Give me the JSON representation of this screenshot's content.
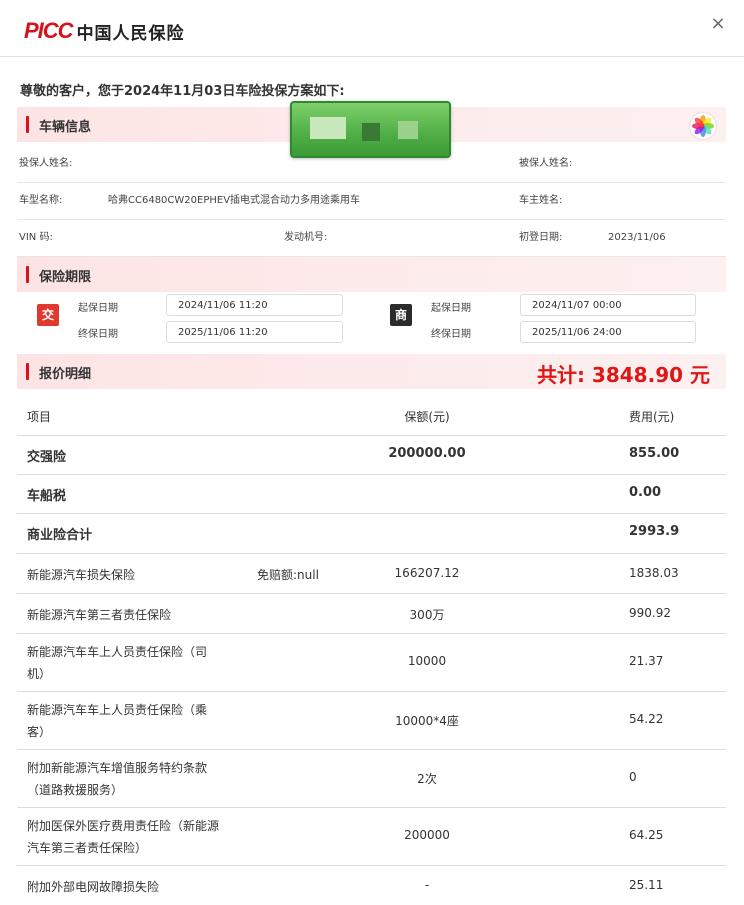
{
  "header": {
    "logo_latin": "PICC",
    "logo_cn": "中国人民保险",
    "close_label": "×"
  },
  "greeting": "尊敬的客户，您于2024年11月03日车险投保方案如下:",
  "vehicle": {
    "section_title": "车辆信息",
    "policyholder_label": "投保人姓名:",
    "insured_label": "被保人姓名:",
    "model_label": "车型名称:",
    "model_value": "哈弗CC6480CW20EPHEV插电式混合动力多用途乘用车",
    "owner_label": "车主姓名:",
    "vin_label": "VIN 码:",
    "engine_label": "发动机号:",
    "first_reg_label": "初登日期:",
    "first_reg_value": "2023/11/06"
  },
  "period": {
    "section_title": "保险期限",
    "compulsory_badge": "交",
    "commercial_badge": "商",
    "start_label": "起保日期",
    "end_label": "终保日期",
    "compulsory_start": "2024/11/06 11:20",
    "compulsory_end": "2025/11/06 11:20",
    "commercial_start": "2024/11/07 00:00",
    "commercial_end": "2025/11/06 24:00"
  },
  "quote": {
    "section_title": "报价明细",
    "total_label": "共计: 3848.90 元",
    "columns": [
      "项目",
      "保额(元)",
      "费用(元)"
    ],
    "rows": [
      {
        "item": "交强险",
        "note": "",
        "amount": "200000.00",
        "fee": "855.00"
      },
      {
        "item": "车船税",
        "note": "",
        "amount": "",
        "fee": "0.00"
      },
      {
        "item": "商业险合计",
        "note": "",
        "amount": "",
        "fee": "2993.9"
      },
      {
        "item": "新能源汽车损失保险",
        "note": "免赔额:null",
        "amount": "166207.12",
        "fee": "1838.03"
      },
      {
        "item": "新能源汽车第三者责任保险",
        "note": "",
        "amount": "300万",
        "fee": "990.92"
      },
      {
        "item_line1": "新能源汽车车上人员责任保险（司",
        "item_line2": "机）",
        "amount": "10000",
        "fee": "21.37"
      },
      {
        "item_line1": "新能源汽车车上人员责任保险（乘",
        "item_line2": "客）",
        "amount": "10000*4座",
        "fee": "54.22"
      },
      {
        "item_line1": "附加新能源汽车增值服务特约条款",
        "item_line2": "（道路救援服务）",
        "amount": "2次",
        "fee": "0"
      },
      {
        "item_line1": "附加医保外医疗费用责任险（新能源",
        "item_line2": "汽车第三者责任保险）",
        "amount": "200000",
        "fee": "64.25"
      },
      {
        "item": "附加外部电网故障损失险",
        "note": "",
        "amount": "-",
        "fee": "25.11"
      }
    ]
  },
  "colors": {
    "brand_red": "#d7121b",
    "total_red": "#e01515",
    "section_bg": "#fde4e4",
    "compulsory_badge": "#e03a2e",
    "commercial_badge": "#2b2b2b"
  },
  "icons": {
    "photos": "photos-icon",
    "close": "close-icon"
  }
}
